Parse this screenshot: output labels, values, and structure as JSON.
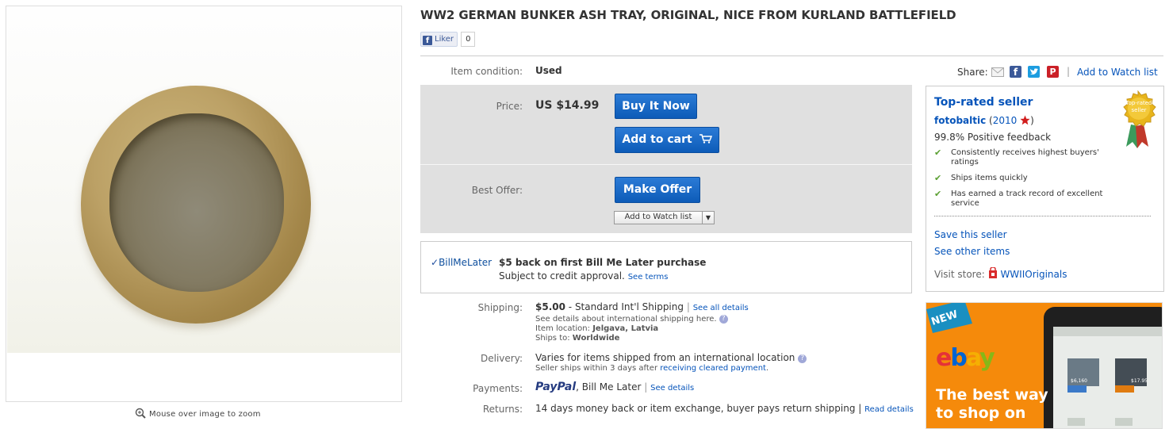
{
  "item": {
    "title": "WW2 GERMAN BUNKER ASH TRAY, ORIGINAL, NICE FROM KURLAND BATTLEFIELD",
    "zoom_hint": "Mouse over image to zoom"
  },
  "social": {
    "fb_like_label": "Liker",
    "fb_like_count": "0",
    "share_label": "Share:",
    "add_watch_list": "Add to Watch list",
    "separator": "|"
  },
  "condition": {
    "label": "Item condition:",
    "value": "Used"
  },
  "price": {
    "label": "Price:",
    "value": "US $14.99",
    "buy_it_now": "Buy It Now",
    "add_to_cart": "Add to cart"
  },
  "best_offer": {
    "label": "Best Offer:",
    "make_offer": "Make Offer",
    "add_watch_list": "Add to Watch list"
  },
  "bill_me_later": {
    "logo_text": "BillMeLater",
    "title": "$5 back on first Bill Me Later purchase",
    "subtitle": "Subject to credit approval.",
    "see_terms": "See terms"
  },
  "shipping": {
    "label": "Shipping:",
    "cost": "$5.00",
    "method": "- Standard Int'l Shipping",
    "see_all": "See all details",
    "intl_note": "See details about international shipping here.",
    "location_label": "Item location:",
    "location": "Jelgava, Latvia",
    "ships_to_label": "Ships to:",
    "ships_to": "Worldwide"
  },
  "delivery": {
    "label": "Delivery:",
    "value": "Varies for items shipped from an international location",
    "note_prefix": "Seller ships within 3 days after",
    "note_link": "receiving cleared payment",
    "note_suffix": "."
  },
  "payments": {
    "label": "Payments:",
    "paypal": "PayPal",
    "others": ", Bill Me Later",
    "see_details": "See details"
  },
  "returns": {
    "label": "Returns:",
    "value": "14 days money back or item exchange, buyer pays return shipping",
    "read_details": "Read details"
  },
  "seller": {
    "status": "Top-rated seller",
    "badge_text": "Top-rated seller",
    "name": "fotobaltic",
    "score": "2010",
    "feedback": "99.8% Positive feedback",
    "bullets": [
      "Consistently receives highest buyers' ratings",
      "Ships items quickly",
      "Has earned a track record of excellent service"
    ],
    "save_seller": "Save this seller",
    "see_other_items": "See other items",
    "visit_store_label": "Visit store:",
    "store_name": "WWIIOriginals"
  },
  "ad": {
    "badge": "NEW",
    "logo": "ebay",
    "tagline_line1": "The best way",
    "tagline_line2": "to shop on",
    "price_a": "$6,160",
    "price_b": "$17.95"
  },
  "colors": {
    "link": "#0654ba",
    "button_blue": "#1565c0",
    "price_box_bg": "#e0e0e0",
    "ad_orange": "#f58a0b",
    "check_green": "#5ba033"
  }
}
